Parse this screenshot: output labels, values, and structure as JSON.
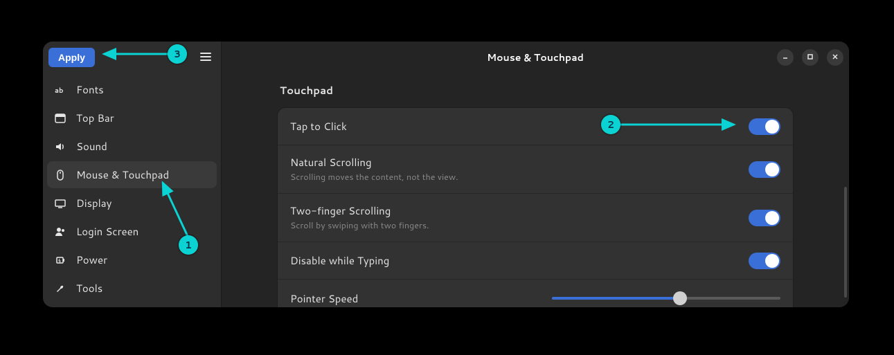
{
  "header": {
    "apply_label": "Apply",
    "title": "Mouse & Touchpad"
  },
  "sidebar": {
    "items": [
      {
        "icon": "fonts-icon",
        "label": "Fonts"
      },
      {
        "icon": "topbar-icon",
        "label": "Top Bar"
      },
      {
        "icon": "sound-icon",
        "label": "Sound"
      },
      {
        "icon": "mouse-icon",
        "label": "Mouse & Touchpad",
        "active": true
      },
      {
        "icon": "display-icon",
        "label": "Display"
      },
      {
        "icon": "login-icon",
        "label": "Login Screen"
      },
      {
        "icon": "power-icon",
        "label": "Power"
      },
      {
        "icon": "tools-icon",
        "label": "Tools"
      }
    ]
  },
  "main": {
    "section_title": "Touchpad",
    "rows": [
      {
        "title": "Tap to Click",
        "desc": "",
        "type": "switch",
        "value": true
      },
      {
        "title": "Natural Scrolling",
        "desc": "Scrolling moves the content, not the view.",
        "type": "switch",
        "value": true
      },
      {
        "title": "Two-finger Scrolling",
        "desc": "Scroll by swiping with two fingers.",
        "type": "switch",
        "value": true
      },
      {
        "title": "Disable while Typing",
        "desc": "",
        "type": "switch",
        "value": true
      },
      {
        "title": "Pointer Speed",
        "desc": "",
        "type": "slider",
        "value": 0.56
      }
    ]
  },
  "annotations": {
    "1": "1",
    "2": "2",
    "3": "3"
  },
  "colors": {
    "accent": "#3a6fd8",
    "annotation": "#0cd3d3"
  }
}
